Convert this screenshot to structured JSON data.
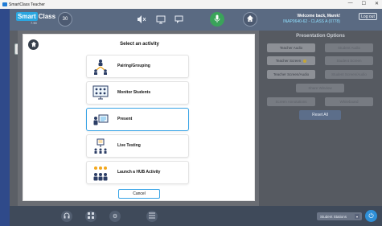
{
  "titlebar": {
    "app_title": "SmartClass Teacher",
    "minimize": "—",
    "maximize": "☐",
    "close": "✕"
  },
  "header": {
    "logo_smart": "Smart",
    "logo_class": "Class",
    "logo_version": "7.90",
    "connected_badge": "30",
    "welcome_line1": "Welcome back, Marek!",
    "welcome_line2": "INAP0640-62 - CLASS A (0778)",
    "logout_label": "Log out"
  },
  "options_panel": {
    "title": "Presentation Options",
    "buttons": [
      {
        "label": "Teacher Audio"
      },
      {
        "label": "Student Audio"
      },
      {
        "label": "Teacher Screen"
      },
      {
        "label": "Student Screen"
      },
      {
        "label": "Teacher Screen/Audio"
      },
      {
        "label": "Student Screen/Audio"
      },
      {
        "label": "Share Window"
      },
      {
        "label": "Screen Annotations"
      },
      {
        "label": "Whiteboard"
      }
    ],
    "reset_label": "Reset All"
  },
  "modal": {
    "title": "Select an activity",
    "activities": [
      {
        "label": "Pairing/Grouping"
      },
      {
        "label": "Monitor Students"
      },
      {
        "label": "Present"
      },
      {
        "label": "Live Testing"
      },
      {
        "label": "Launch a HUB Activity"
      }
    ],
    "cancel_label": "Cancel"
  },
  "bottombar": {
    "student_select": "Student Stations"
  },
  "colors": {
    "accent_blue": "#36a3e6",
    "mic_green": "#3aa35a",
    "header_bg": "#5a6a82"
  }
}
